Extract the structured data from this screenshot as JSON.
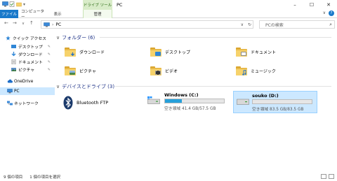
{
  "window": {
    "title": "PC",
    "context_tab": "ドライブ ツール",
    "minimize": "–",
    "maximize": "☐",
    "close": "✕"
  },
  "ribbon": {
    "file": "ファイル",
    "computer": "コンピューター",
    "view": "表示",
    "manage": "管理",
    "expand": "∨"
  },
  "address": {
    "back": "←",
    "forward": "→",
    "up_history": "∨",
    "up": "↑",
    "path": "PC",
    "refresh": "↻",
    "search_placeholder": "PCの検索"
  },
  "navpane": {
    "items": [
      {
        "label": "クイック アクセス"
      },
      {
        "label": "デスクトップ"
      },
      {
        "label": "ダウンロード"
      },
      {
        "label": "ドキュメント"
      },
      {
        "label": "ピクチャ"
      },
      {
        "label": "OneDrive"
      },
      {
        "label": "PC"
      },
      {
        "label": "ネットワーク"
      }
    ]
  },
  "content": {
    "folders_group": "フォルダー (6)",
    "folders": [
      {
        "label": "ダウンロード"
      },
      {
        "label": "デスクトップ"
      },
      {
        "label": "ドキュメント"
      },
      {
        "label": "ピクチャ"
      },
      {
        "label": "ビデオ"
      },
      {
        "label": "ミュージック"
      }
    ],
    "devices_group": "デバイスとドライブ (3)",
    "bluetooth": "Bluetooth FTP",
    "drives": [
      {
        "name": "Windows (C:)",
        "free_text": "空き領域 41.4 GB/57.5 GB",
        "used_fraction": 0.28
      },
      {
        "name": "souko (D:)",
        "free_text": "空き領域 83.5 GB/83.5 GB",
        "used_fraction": 0.0
      }
    ]
  },
  "status": {
    "count": "9 個の項目",
    "selected": "1 個の項目を選択"
  }
}
